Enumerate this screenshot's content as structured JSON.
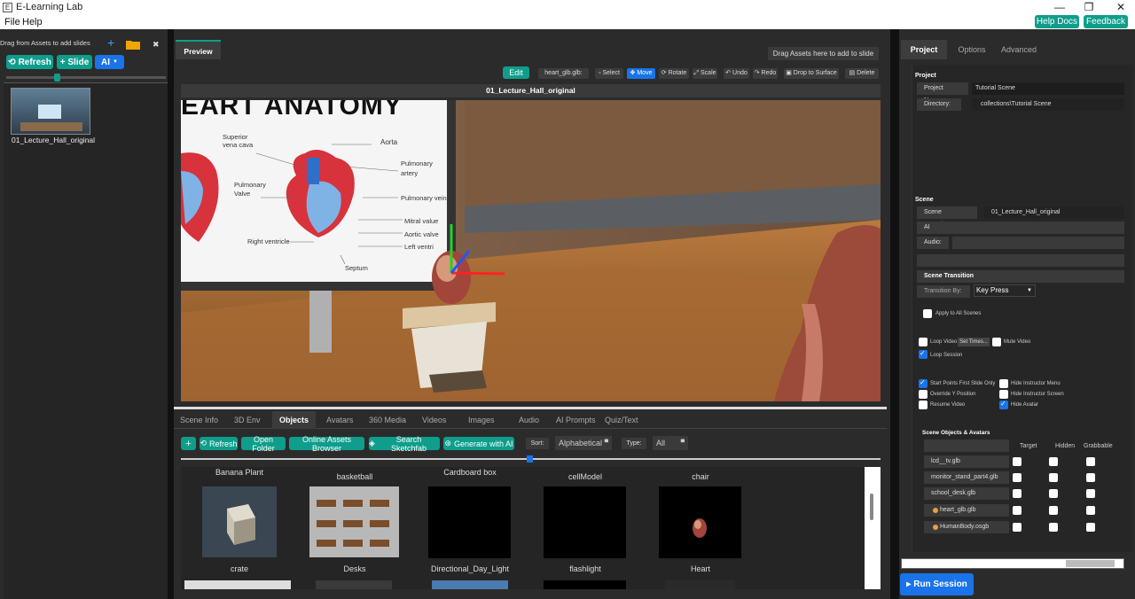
{
  "window": {
    "title": "E-Learning Lab",
    "controls": [
      "—",
      "❐",
      "✕"
    ]
  },
  "menu": {
    "file": "File",
    "help": "Help",
    "help_docs": "Help Docs",
    "feedback": "Feedback"
  },
  "left": {
    "hint": "Drag from Assets to add slides",
    "plus": "+",
    "close": "✖",
    "refresh": "Refresh",
    "slide": "+ Slide",
    "ai": "AI",
    "slides": [
      {
        "label": "01_Lecture_Hall_original"
      }
    ]
  },
  "preview": {
    "tab": "Preview",
    "drag_hint": "Drag Assets here to add to slide",
    "edit": "Edit",
    "selected_file": "heart_glb.glb:",
    "tools": [
      "Select",
      "Move",
      "Rotate",
      "Scale",
      "Undo",
      "Redo",
      "Drop to Surface",
      "Delete"
    ],
    "scene_title": "01_Lecture_Hall_original",
    "board": {
      "title": "EART ANATOMY",
      "labels": [
        "Superior vena cava",
        "Aorta",
        "Pulmonary artery",
        "Pulmonary Valve",
        "Pulmonary vein",
        "Mitral value",
        "Aortic valve",
        "Left ventri",
        "Right ventricle",
        "Septum"
      ]
    }
  },
  "assets": {
    "tabs": [
      "Scene Info",
      "3D Env",
      "Objects",
      "Avatars",
      "360 Media",
      "Videos",
      "Images",
      "Audio",
      "AI Prompts",
      "Quiz/Text"
    ],
    "active_tab": "Objects",
    "add": "+",
    "refresh": "Refresh",
    "open_folder": "Open Folder",
    "online": "Online Assets Browser",
    "search": "Search Sketchfab",
    "generate": "Generate with AI",
    "sort_label": "Sort:",
    "sort_value": "Alphabetical",
    "type_label": "Type:",
    "type_value": "All",
    "row1": [
      "Banana Plant",
      "basketball",
      "Cardboard box",
      "cellModel",
      "chair"
    ],
    "row2": [
      "crate",
      "Desks",
      "Directional_Day_Light",
      "flashlight",
      "Heart"
    ]
  },
  "right": {
    "tabs": [
      "Project",
      "Options",
      "Advanced"
    ],
    "project_sec": "Project",
    "project_name_label": "Project Name:",
    "project_name": "Tutorial Scene",
    "directory_label": "Directory:",
    "directory": "collections\\Tutorial Scene",
    "scene_sec": "Scene",
    "scene_name_label": "Scene Name/Env:",
    "scene_name": "01_Lecture_Hall_original",
    "ai_prompt_label": "AI Prompt:",
    "audio_label": "Audio:",
    "transition_sec": "Scene Transition",
    "transition_by_label": "Transition By:",
    "transition_by": "Key Press",
    "apply_all": "Apply to All Scenes",
    "loop_video": "Loop Video",
    "set_times": "Set Times...",
    "mute_video": "Mute Video",
    "loop_session": "Loop Session",
    "start_points": "Start Points First Slide Only",
    "hide_instructor_menu": "Hide Instructor Menu",
    "override_y": "Override Y Position",
    "hide_instructor_screen": "Hide Instructor Screen",
    "resume_video": "Resume Video",
    "hide_avatar": "Hide Avatar",
    "objects_sec": "Scene Objects & Avatars",
    "col_target": "Target",
    "col_hidden": "Hidden",
    "col_grabbable": "Grabbable",
    "objects": [
      "lcd__tv.glb",
      "monitor_stand_part4.glb",
      "school_desk.glb",
      "heart_glb.glb",
      "HumanBody.osgb"
    ],
    "run": "Run Session"
  }
}
